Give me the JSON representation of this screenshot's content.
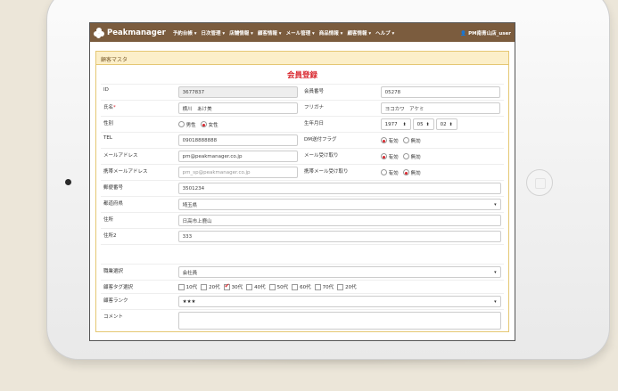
{
  "nav": {
    "brand": "Peakmanager",
    "items": [
      "予約台帳 ▾",
      "日次管理 ▾",
      "店舗情報 ▾",
      "顧客情報 ▾",
      "メール管理 ▾",
      "商品情報 ▾",
      "顧客情報 ▾",
      "ヘルプ ▾"
    ],
    "user": "PM南青山店_user"
  },
  "panel": {
    "heading": "顧客マスタ",
    "title": "会員登録"
  },
  "form": {
    "id_label": "ID",
    "id_value": "3677837",
    "member_no_label": "会員番号",
    "member_no_value": "05278",
    "name_label": "氏名",
    "name_required": "*",
    "name_value": "横川　あけ美",
    "kana_label": "フリガナ",
    "kana_value": "ヨコカワ　アケミ",
    "gender_label": "性別",
    "gender_male": "男性",
    "gender_female": "女性",
    "birthday_label": "生年月日",
    "birth_year": "1977",
    "birth_month": "05",
    "birth_day": "02",
    "tel_label": "TEL",
    "tel_value": "09018888888",
    "dm_label": "DM送付フラグ",
    "dm_yes": "有効",
    "dm_no": "無効",
    "email_label": "メールアドレス",
    "email_value": "pm@peakmanager.co.jp",
    "email_receive_label": "メール受け取り",
    "email_receive_yes": "有効",
    "email_receive_no": "無効",
    "mobile_email_label": "携帯メールアドレス",
    "mobile_email_placeholder": "pm_sp@peakmanager.co.jp",
    "mobile_receive_label": "携帯メール受け取り",
    "mobile_receive_yes": "有効",
    "mobile_receive_no": "無効",
    "zip_label": "郵便番号",
    "zip_value": "3501234",
    "pref_label": "都道府県",
    "pref_value": "埼玉県",
    "address_label": "住所",
    "address_value": "日高市上鹿山",
    "address2_label": "住所2",
    "address2_value": "333",
    "job_label": "職業選択",
    "job_value": "会社員",
    "tag_label": "顧客タグ選択",
    "tags": [
      "10代",
      "20代",
      "30代",
      "40代",
      "50代",
      "60代",
      "70代",
      "20代"
    ],
    "rank_label": "顧客ランク",
    "rank_value": "★★★",
    "comment_label": "コメント"
  },
  "colors": {
    "navbar": "#7b5c3e",
    "accent": "#d9262d",
    "panel_heading": "#fcefc9"
  }
}
